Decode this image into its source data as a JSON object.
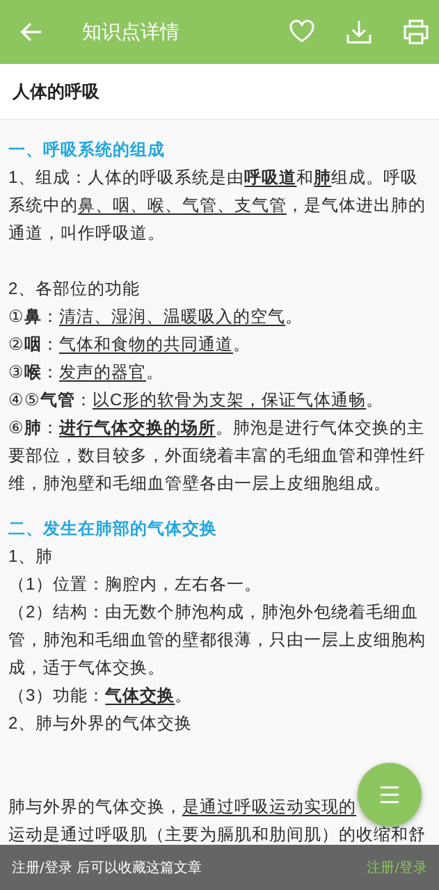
{
  "app_bar": {
    "title": "知识点详情"
  },
  "article_title": "人体的呼吸",
  "blocks": [
    {
      "kind": "heading",
      "text": "一、呼吸系统的组成"
    },
    {
      "kind": "para",
      "runs": [
        {
          "text": "1、组成：人体的呼吸系统是由"
        },
        {
          "text": "呼吸道",
          "bold": true,
          "underline": true
        },
        {
          "text": "和"
        },
        {
          "text": "肺",
          "bold": true,
          "underline": true
        },
        {
          "text": "组成。呼吸系统中的"
        },
        {
          "text": "鼻、咽、喉、气管、支气管",
          "underline": true
        },
        {
          "text": "，是气体进出肺的通道，叫作呼吸道。"
        }
      ]
    },
    {
      "kind": "blank"
    },
    {
      "kind": "para",
      "runs": [
        {
          "text": "2、各部位的功能"
        }
      ]
    },
    {
      "kind": "para",
      "runs": [
        {
          "text": "①"
        },
        {
          "text": "鼻",
          "bold": true
        },
        {
          "text": "："
        },
        {
          "text": "清洁、湿润、温暖吸入的空气",
          "underline": true
        },
        {
          "text": "。"
        }
      ]
    },
    {
      "kind": "para",
      "runs": [
        {
          "text": "②"
        },
        {
          "text": "咽",
          "bold": true
        },
        {
          "text": "："
        },
        {
          "text": "气体和食物的共同通道",
          "underline": true
        },
        {
          "text": "。"
        }
      ]
    },
    {
      "kind": "para",
      "runs": [
        {
          "text": "③"
        },
        {
          "text": "喉",
          "bold": true
        },
        {
          "text": "："
        },
        {
          "text": "发声的器官",
          "underline": true
        },
        {
          "text": "。"
        }
      ]
    },
    {
      "kind": "para",
      "runs": [
        {
          "text": "④⑤"
        },
        {
          "text": "气管",
          "bold": true
        },
        {
          "text": "："
        },
        {
          "text": "以C形的软骨为支架，保证气体通畅",
          "underline": true
        },
        {
          "text": "。"
        }
      ]
    },
    {
      "kind": "para",
      "runs": [
        {
          "text": "⑥"
        },
        {
          "text": "肺",
          "bold": true
        },
        {
          "text": "："
        },
        {
          "text": "进行气体交换的场所",
          "bold": true,
          "underline": true
        },
        {
          "text": "。肺泡是进行气体交换的主要部位，数目较多，外面绕着丰富的毛细血管和弹性纤维，肺泡壁和毛细血管壁各由一层上皮细胞组成。"
        }
      ]
    },
    {
      "kind": "heading",
      "text": "二、发生在肺部的气体交换"
    },
    {
      "kind": "para",
      "runs": [
        {
          "text": "1、肺"
        }
      ]
    },
    {
      "kind": "para",
      "runs": [
        {
          "text": "（1）位置：胸腔内，左右各一。"
        }
      ]
    },
    {
      "kind": "para",
      "runs": [
        {
          "text": "（2）结构：由无数个肺泡构成，肺泡外包绕着毛细血管，肺泡和毛细血管的壁都很薄，只由一层上皮细胞构成，适于气体交换。"
        }
      ]
    },
    {
      "kind": "para",
      "runs": [
        {
          "text": "（3）功能："
        },
        {
          "text": "气体交换",
          "bold": true,
          "underline": true
        },
        {
          "text": "。"
        }
      ]
    },
    {
      "kind": "para",
      "runs": [
        {
          "text": "2、肺与外界的气体交换"
        }
      ]
    },
    {
      "kind": "blank"
    },
    {
      "kind": "blank"
    },
    {
      "kind": "partial",
      "runs": [
        {
          "text": "肺与外界的气体交换，"
        },
        {
          "text": "是通过呼吸运动实现的",
          "underline": true
        }
      ]
    },
    {
      "kind": "para",
      "runs": [
        {
          "text": "运动是通过呼吸肌（主要为膈肌和肋间肌）的收缩和舒"
        }
      ]
    }
  ],
  "login_bar": {
    "message": "注册/登录 后可以收藏这篇文章",
    "link": "注册/登录"
  }
}
